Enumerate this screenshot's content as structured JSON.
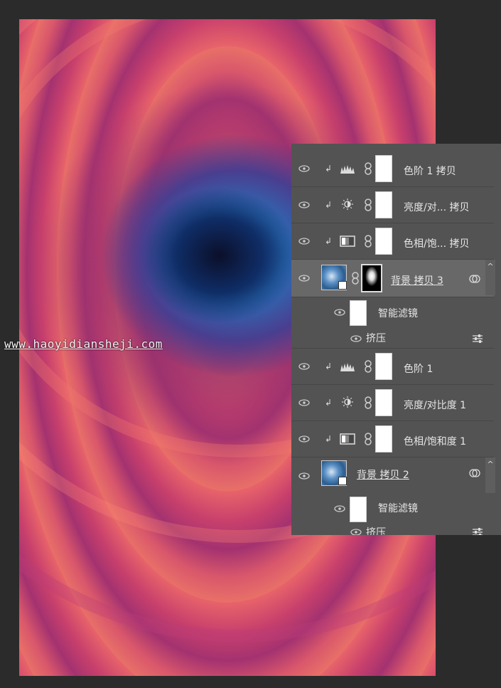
{
  "watermark": "www.haoyidiansheji.com",
  "layers": [
    {
      "label": "色阶 1 拷贝",
      "icon": "levels-icon"
    },
    {
      "label": "亮度/对... 拷贝",
      "icon": "brightness-icon"
    },
    {
      "label": "色相/饱... 拷贝",
      "icon": "hue-saturation-icon"
    },
    {
      "label": "背景 拷贝 3",
      "icon": "smart-object-thumbnail"
    },
    {
      "label": "智能滤镜",
      "icon": "filter-mask"
    },
    {
      "label": "挤压",
      "icon": "filter-options-icon"
    },
    {
      "label": "色阶 1",
      "icon": "levels-icon"
    },
    {
      "label": "亮度/对比度 1",
      "icon": "brightness-icon"
    },
    {
      "label": "色相/饱和度 1",
      "icon": "hue-saturation-icon"
    },
    {
      "label": "背景 拷贝 2",
      "icon": "smart-object-thumbnail"
    },
    {
      "label": "智能滤镜",
      "icon": "filter-mask"
    },
    {
      "label": "挤压",
      "icon": "filter-options-icon"
    }
  ],
  "scroll_up_glyph": "^",
  "colors": {
    "panel_bg": "#535353",
    "selected_row": "#686868",
    "canvas_bg": "#2b2b2b"
  }
}
